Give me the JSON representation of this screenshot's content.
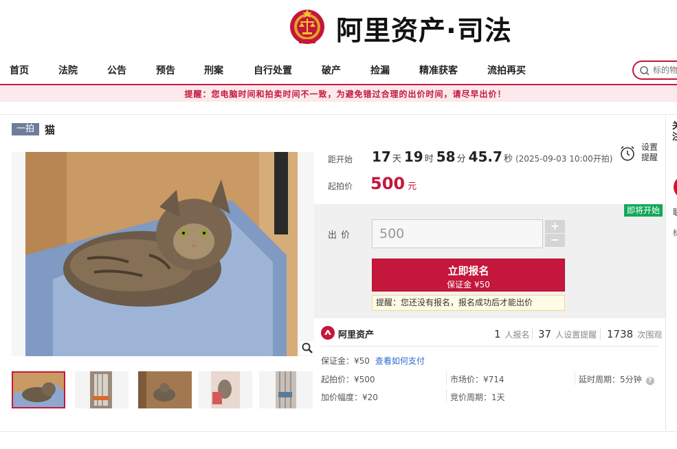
{
  "header": {
    "logo_text": "阿里资产·司法"
  },
  "nav": {
    "items": [
      "首页",
      "法院",
      "公告",
      "预告",
      "刑案",
      "自行处置",
      "破产",
      "捡漏",
      "精准获客",
      "流拍再买"
    ],
    "search_placeholder": "标的物"
  },
  "notice": "提醒：您电脑时间和拍卖时间不一致，为避免错过合理的出价时间，请尽早出价！",
  "item": {
    "tag": "一拍",
    "title": "猫"
  },
  "countdown": {
    "label": "距开始",
    "days": "17",
    "days_unit": "天",
    "hours": "19",
    "hours_unit": "时",
    "minutes": "58",
    "minutes_unit": "分",
    "seconds": "45.7",
    "seconds_unit": "秒",
    "start_time": "(2025-09-03 10:00开拍)"
  },
  "start_price": {
    "label": "起拍价",
    "value": "500",
    "unit": "元"
  },
  "remind": {
    "label": "设置提醒"
  },
  "bid": {
    "badge": "即将开始",
    "label": "出价",
    "value": "500",
    "plus": "+",
    "minus": "−",
    "signup_label": "立即报名",
    "deposit_label": "保证金 ¥50",
    "hint": "提醒：您还没有报名，报名成功后才能出价"
  },
  "info": {
    "brand": "阿里资产",
    "signup_count": "1",
    "signup_unit": "人报名",
    "remind_count": "37",
    "remind_unit": "人设置提醒",
    "view_count": "1738",
    "view_unit": "次围观",
    "deposit": "保证金：¥50",
    "deposit_link": "查看如何支付",
    "start_price": "起拍价：¥500",
    "market_price": "市场价：¥714",
    "delay_period": "延时周期：5分钟",
    "increment": "加价幅度：¥20",
    "bid_period": "竞价周期：1天"
  },
  "side": {
    "title": "关注",
    "text1": "联",
    "text2": "标"
  },
  "colors": {
    "brand_red": "#c5163b",
    "badge_green": "#12a85a",
    "tag_gray": "#6f7c9c",
    "link_blue": "#2a6acb"
  }
}
